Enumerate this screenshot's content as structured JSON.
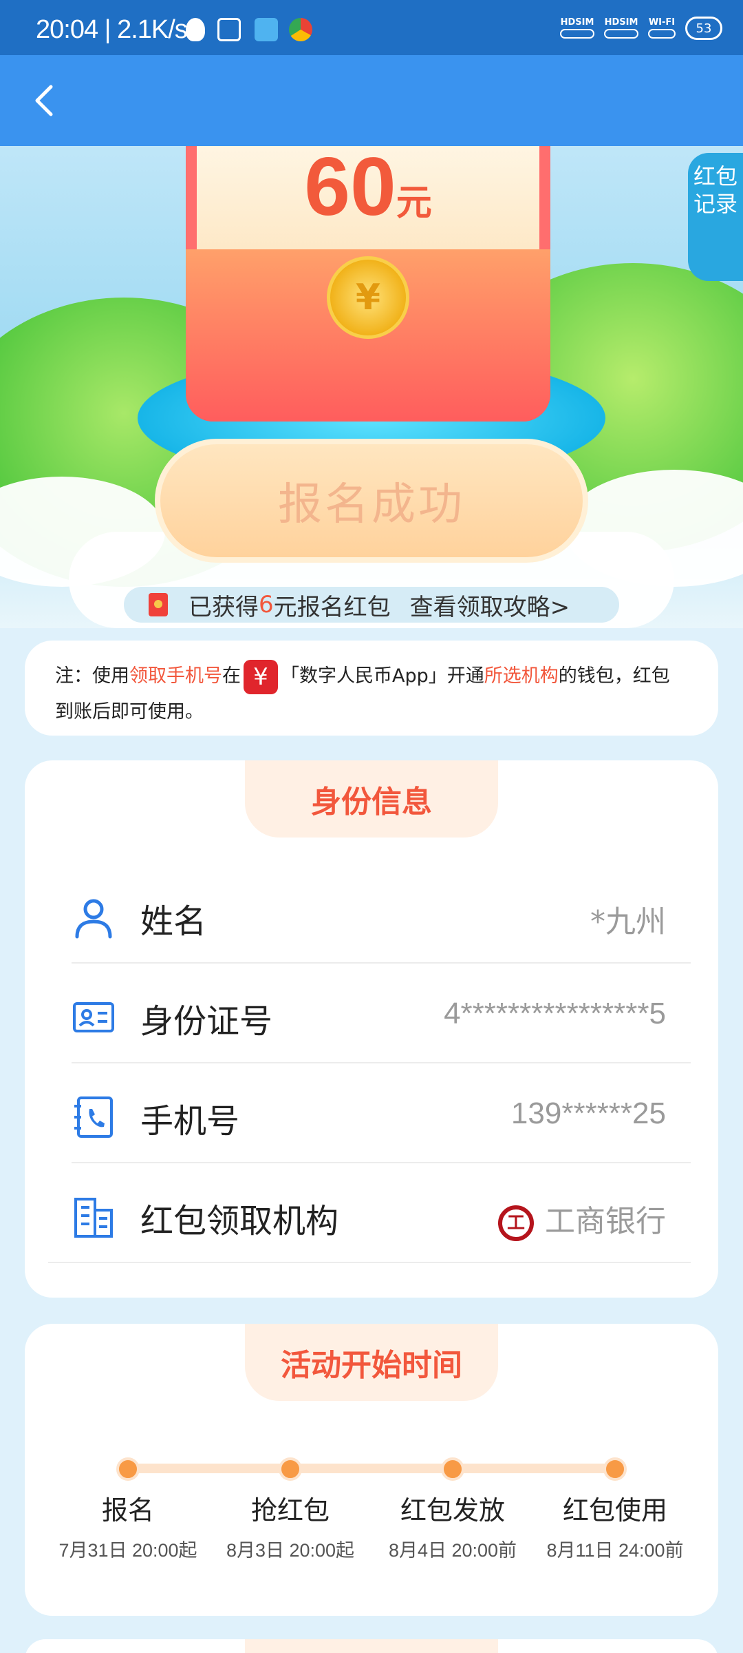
{
  "status_bar": {
    "time": "20:04 | 2.1K/s",
    "sim1": "HDSIM",
    "sim2": "HDSIM",
    "wifi": "WI-FI",
    "battery": "53"
  },
  "hero": {
    "amount": "60",
    "unit": "元",
    "status_button": "报名成功",
    "record_tab": "红包记录"
  },
  "banner": {
    "prefix": "已获得",
    "amount": "6",
    "suffix": "元报名红包",
    "link": "查看领取攻略>"
  },
  "note": {
    "p1": "注：使用",
    "hl1": "领取手机号",
    "p2": "在",
    "p3": "「数字人民币App」开通",
    "hl2": "所选机构",
    "p4": "的钱包，红包到账后即可使用。"
  },
  "identity": {
    "title": "身份信息",
    "rows": [
      {
        "label": "姓名",
        "value": "*九州",
        "icon": "user-icon"
      },
      {
        "label": "身份证号",
        "value": "4****************5",
        "icon": "id-card-icon"
      },
      {
        "label": "手机号",
        "value": "139******25",
        "icon": "phone-book-icon"
      },
      {
        "label": "红包领取机构",
        "value": "工商银行",
        "icon": "building-icon"
      }
    ]
  },
  "timeline": {
    "title": "活动开始时间",
    "steps": [
      {
        "name": "报名",
        "time": "7月31日 20:00起"
      },
      {
        "name": "抢红包",
        "time": "8月3日 20:00起"
      },
      {
        "name": "红包发放",
        "time": "8月4日 20:00前"
      },
      {
        "name": "红包使用",
        "time": "8月11日 24:00前"
      }
    ]
  },
  "colors": {
    "header": "#3a93ef",
    "status_bar": "#1f6fc4",
    "accent": "#f2573c",
    "timeline_dot": "#f89a45"
  }
}
